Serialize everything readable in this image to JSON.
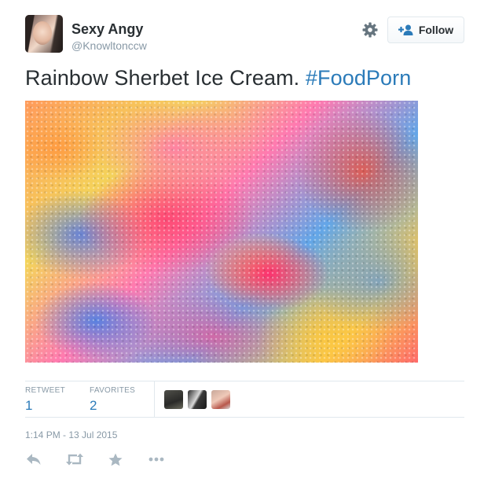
{
  "user": {
    "name": "Sexy Angy",
    "handle": "@Knowltonccw"
  },
  "follow_button": {
    "label": "Follow"
  },
  "tweet": {
    "text": "Rainbow Sherbet Ice Cream.",
    "hashtag": "#FoodPorn"
  },
  "stats": {
    "retweets_label": "RETWEET",
    "retweets_value": "1",
    "favorites_label": "FAVORITES",
    "favorites_value": "2"
  },
  "timestamp": "1:14 PM - 13 Jul 2015",
  "icons": {
    "settings": "gear-icon",
    "follow": "add-user-icon",
    "reply": "reply-icon",
    "retweet": "retweet-icon",
    "favorite": "star-icon",
    "more": "more-icon"
  },
  "colors": {
    "link": "#2b7bb9",
    "muted": "#8899a6",
    "text": "#292f33",
    "border": "#e1e8ed"
  }
}
